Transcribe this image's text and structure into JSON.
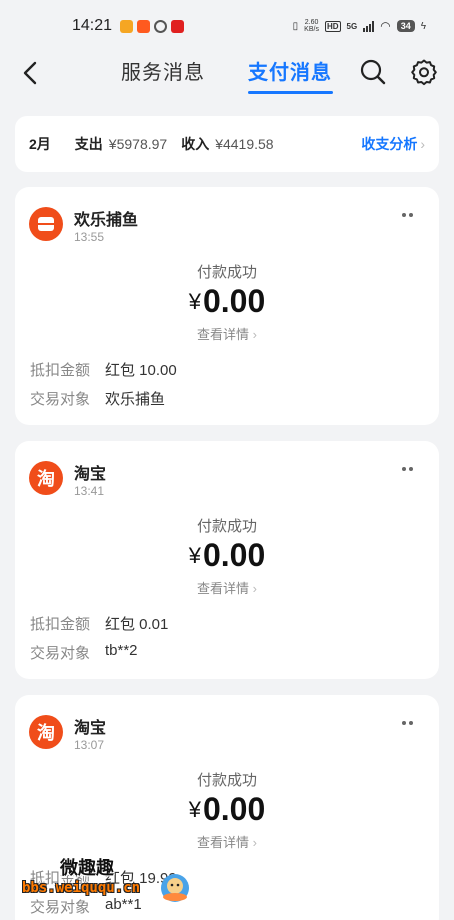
{
  "status_bar": {
    "time": "14:21",
    "net_speed_value": "2.60",
    "net_speed_unit": "KB/s",
    "hd": "HD",
    "network": "5G",
    "battery": "34"
  },
  "header": {
    "tabs": [
      {
        "label": "服务消息",
        "active": false
      },
      {
        "label": "支付消息",
        "active": true
      }
    ],
    "accent_color": "#1677ff"
  },
  "summary": {
    "month": "2月",
    "expense_label": "支出",
    "expense_amount": "¥5978.97",
    "income_label": "收入",
    "income_amount": "¥4419.58",
    "analysis_label": "收支分析"
  },
  "cards": [
    {
      "logo_text": "",
      "merchant": "欢乐捕鱼",
      "time": "13:55",
      "status": "付款成功",
      "currency": "¥",
      "amount": "0.00",
      "details_label": "查看详情",
      "deduction_label": "抵扣金额",
      "deduction_value": "红包 10.00",
      "counterparty_label": "交易对象",
      "counterparty_value": "欢乐捕鱼"
    },
    {
      "logo_text": "淘",
      "merchant": "淘宝",
      "time": "13:41",
      "status": "付款成功",
      "currency": "¥",
      "amount": "0.00",
      "details_label": "查看详情",
      "deduction_label": "抵扣金额",
      "deduction_value": "红包 0.01",
      "counterparty_label": "交易对象",
      "counterparty_value": "tb**2"
    },
    {
      "logo_text": "淘",
      "merchant": "淘宝",
      "time": "13:07",
      "status": "付款成功",
      "currency": "¥",
      "amount": "0.00",
      "details_label": "查看详情",
      "deduction_label": "抵扣金额",
      "deduction_value": "红包 19.99",
      "counterparty_label": "交易对象",
      "counterparty_value": "ab**1"
    }
  ],
  "watermark": {
    "title": "微趣趣",
    "url": "bbs.weiququ.cn"
  }
}
